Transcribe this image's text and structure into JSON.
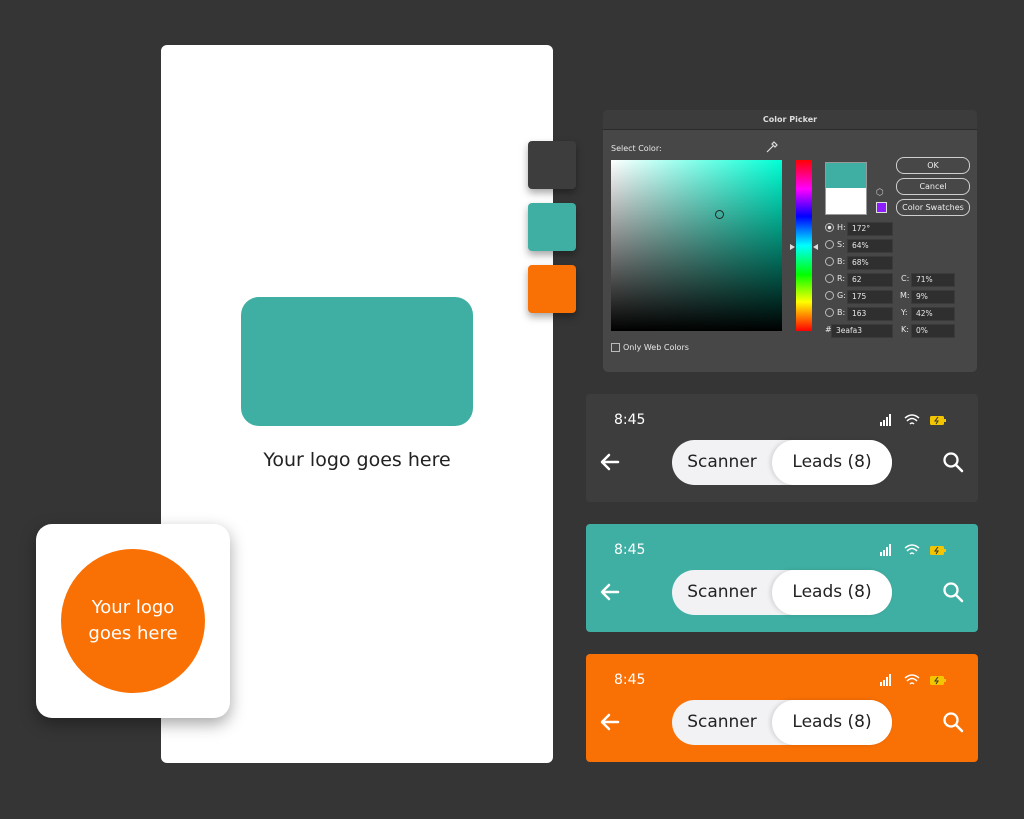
{
  "colors": {
    "background": "#353535",
    "dark": "#3d3d3d",
    "teal": "#3fafa3",
    "orange": "#f97005"
  },
  "logo_preview": {
    "caption": "Your logo goes here"
  },
  "app_icon": {
    "text": "Your logo\ngoes here"
  },
  "swatches": [
    {
      "name": "dark",
      "color": "#3d3d3d"
    },
    {
      "name": "teal",
      "color": "#3fafa3"
    },
    {
      "name": "orange",
      "color": "#f97005"
    }
  ],
  "color_picker": {
    "title": "Color Picker",
    "select_label": "Select Color:",
    "buttons": {
      "ok": "OK",
      "cancel": "Cancel",
      "swatches": "Color Swatches"
    },
    "fields": {
      "H": {
        "label": "H:",
        "value": "172°"
      },
      "S": {
        "label": "S:",
        "value": "64%"
      },
      "Bri": {
        "label": "B:",
        "value": "68%"
      },
      "R": {
        "label": "R:",
        "value": "62"
      },
      "G": {
        "label": "G:",
        "value": "175"
      },
      "Blu": {
        "label": "B:",
        "value": "163"
      },
      "hex": {
        "label": "#",
        "value": "3eafa3"
      },
      "C": {
        "label": "C:",
        "value": "71%"
      },
      "M": {
        "label": "M:",
        "value": "9%"
      },
      "Y": {
        "label": "Y:",
        "value": "42%"
      },
      "K": {
        "label": "K:",
        "value": "0%"
      }
    },
    "web_colors_label": "Only Web Colors",
    "web_colors_checked": false
  },
  "app_bars": [
    {
      "theme": "dark",
      "background": "#3d3d3d",
      "time": "8:45",
      "tab_scanner": "Scanner",
      "tab_leads": "Leads (8)"
    },
    {
      "theme": "teal",
      "background": "#3fafa3",
      "time": "8:45",
      "tab_scanner": "Scanner",
      "tab_leads": "Leads (8)"
    },
    {
      "theme": "orange",
      "background": "#f97005",
      "time": "8:45",
      "tab_scanner": "Scanner",
      "tab_leads": "Leads (8)"
    }
  ]
}
